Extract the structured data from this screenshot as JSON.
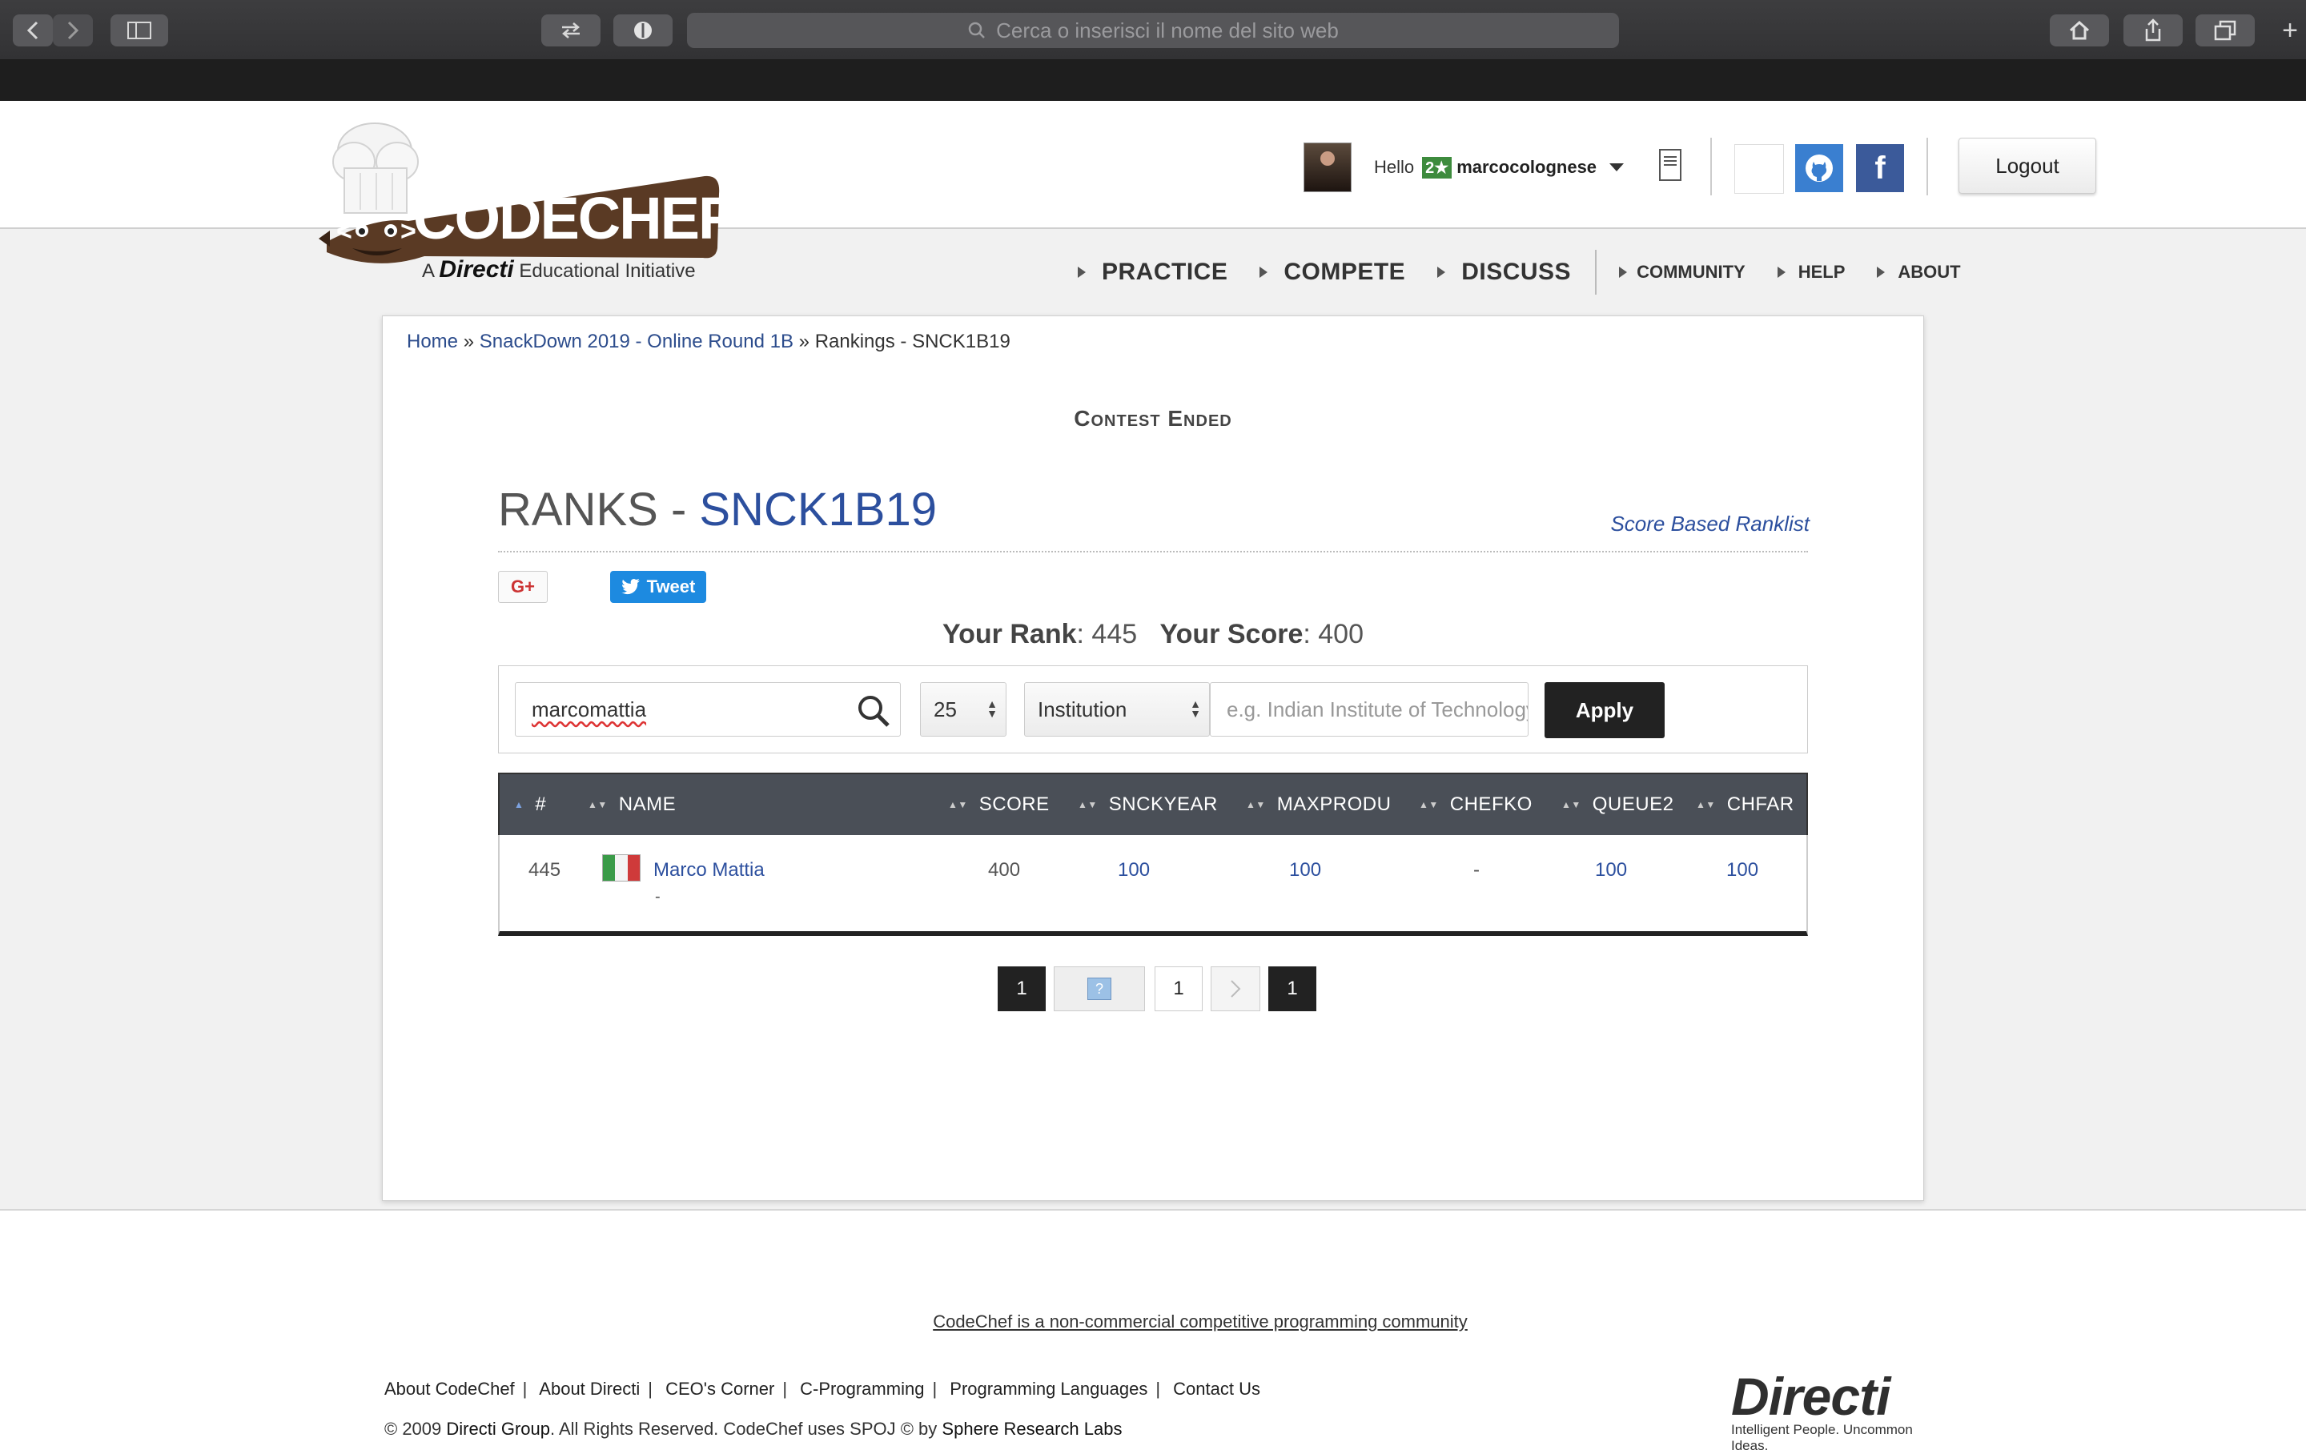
{
  "browser": {
    "url_placeholder": "Cerca o inserisci il nome del sito web"
  },
  "header": {
    "logo_text": "CODECHEF",
    "logo_tagline_prefix": "A",
    "logo_tagline_brand": "Directi",
    "logo_tagline_suffix": "Educational Initiative",
    "greeting": "Hello",
    "star_rating": "2★",
    "username": "marcocolognese",
    "logout_label": "Logout"
  },
  "nav": {
    "main": [
      "PRACTICE",
      "COMPETE",
      "DISCUSS"
    ],
    "secondary": [
      "COMMUNITY",
      "HELP",
      "ABOUT"
    ]
  },
  "breadcrumb": {
    "home": "Home",
    "contest": "SnackDown 2019 - Online Round 1B",
    "separator": "»",
    "current": "Rankings - SNCK1B19"
  },
  "contest_status": "Contest Ended",
  "ranks": {
    "title_prefix": "RANKS - ",
    "contest_code": "SNCK1B19",
    "score_based_link": "Score Based Ranklist"
  },
  "social": {
    "gplus_label": "G+",
    "tweet_label": "Tweet"
  },
  "your_stats": {
    "rank_label": "Your Rank",
    "rank_value": "445",
    "score_label": "Your Score",
    "score_value": "400"
  },
  "filters": {
    "search_value": "marcomattia",
    "page_size": "25",
    "filter_type": "Institution",
    "institution_placeholder": "e.g. Indian Institute of Technology",
    "apply_label": "Apply"
  },
  "table": {
    "headers": [
      "#",
      "NAME",
      "SCORE",
      "SNCKYEAR",
      "MAXPRODU",
      "CHEFKO",
      "QUEUE2",
      "CHFAR"
    ],
    "rows": [
      {
        "rank": "445",
        "name": "Marco Mattia",
        "sub": "-",
        "score": "400",
        "snckyear": "100",
        "maxprodu": "100",
        "chefko": "-",
        "queue2": "100",
        "chfar": "100"
      }
    ]
  },
  "pagination": {
    "first": "1",
    "current": "1",
    "last": "1"
  },
  "footer": {
    "tagline": "CodeChef is a non-commercial competitive programming community",
    "links": [
      "About CodeChef",
      "About Directi",
      "CEO's Corner",
      "C-Programming",
      "Programming Languages",
      "Contact Us"
    ],
    "copyright_prefix": "© 2009",
    "copyright_company": "Directi Group",
    "copyright_middle": ". All Rights Reserved. CodeChef uses SPOJ © by",
    "copyright_labs": "Sphere Research Labs",
    "directi_logo": "Directi",
    "directi_slogan": "Intelligent People. Uncommon Ideas."
  },
  "colors": {
    "link_blue": "#2c4f9e",
    "table_header": "#4a4f57",
    "tweet_blue": "#1d8ae0",
    "github_blue": "#3a7fd0",
    "facebook_blue": "#3b5a9a"
  }
}
